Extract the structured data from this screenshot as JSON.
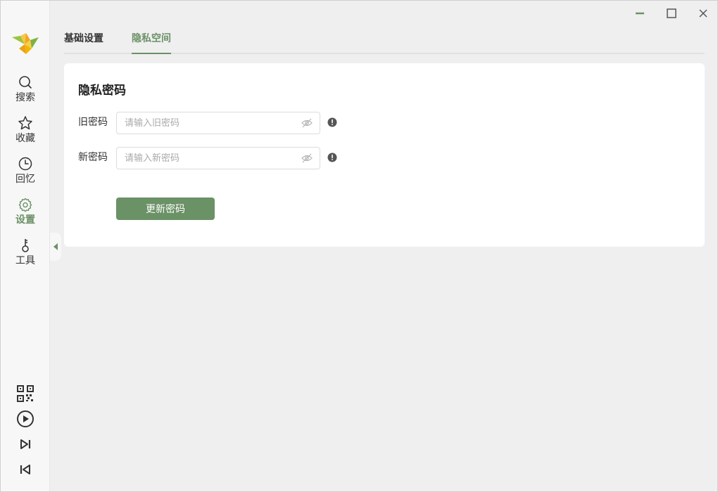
{
  "sidebar": {
    "logo_icon": "bird-logo-icon",
    "items": [
      {
        "label": "搜索",
        "icon": "search-icon"
      },
      {
        "label": "收藏",
        "icon": "star-icon"
      },
      {
        "label": "回忆",
        "icon": "clock-icon"
      },
      {
        "label": "设置",
        "icon": "gear-icon",
        "active": true
      },
      {
        "label": "工具",
        "icon": "tool-icon"
      }
    ],
    "bottom_icons": [
      "qr-code-icon",
      "play-icon",
      "skip-next-icon",
      "skip-previous-icon"
    ]
  },
  "window_controls": [
    "minimize-icon",
    "maximize-icon",
    "close-icon"
  ],
  "tabs": [
    {
      "label": "基础设置",
      "active": false
    },
    {
      "label": "隐私空间",
      "active": true
    }
  ],
  "card": {
    "title": "隐私密码",
    "old_password": {
      "label": "旧密码",
      "placeholder": "请输入旧密码",
      "value": ""
    },
    "new_password": {
      "label": "新密码",
      "placeholder": "请输入新密码",
      "value": ""
    },
    "submit_label": "更新密码"
  },
  "colors": {
    "accent": "#6b9166",
    "background": "#efefef",
    "sidebar": "#f7f7f7",
    "card": "#ffffff"
  }
}
